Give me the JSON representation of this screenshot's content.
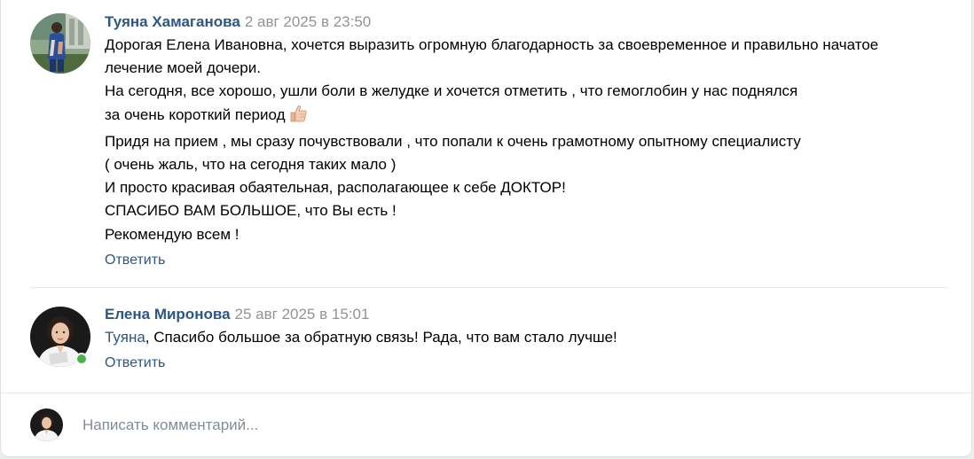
{
  "comments": [
    {
      "author": "Туяна Хамаганова",
      "date": "2 авг 2025 в 23:50",
      "avatar": "user-photo-avatar",
      "lines": [
        "Дорогая Елена Ивановна, хочется выразить огромную благодарность за своевременное и правильно начатое",
        "лечение моей дочери.",
        "На сегодня, все хорошо, ушли боли в желудке и хочется отметить , что гемоглобин у нас поднялся",
        "за очень короткий период",
        "Придя на прием , мы сразу почувствовали , что попали к очень грамотному опытному специалисту",
        "( очень жаль, что на сегодня таких мало )",
        "И просто красивая обаятельная, располагающее к себе ДОКТОР!",
        "СПАСИБО ВАМ БОЛЬШОЕ, что Вы есть !",
        "Рекомендую всем !"
      ],
      "emoji": "thumbs-up-icon",
      "reply_label": "Ответить"
    },
    {
      "author": "Елена Миронова",
      "date": "25 авг 2025 в 15:01",
      "avatar": "doctor-photo-avatar",
      "online": true,
      "mention": "Туяна",
      "text": ", Спасибо большое за обратную связь! Рада, что вам стало лучше!",
      "reply_label": "Ответить"
    }
  ],
  "composer": {
    "placeholder": "Написать комментарий..."
  },
  "colors": {
    "link": "#2a5885",
    "date": "#939393",
    "online": "#4bb34b",
    "placeholder": "#818c99"
  }
}
